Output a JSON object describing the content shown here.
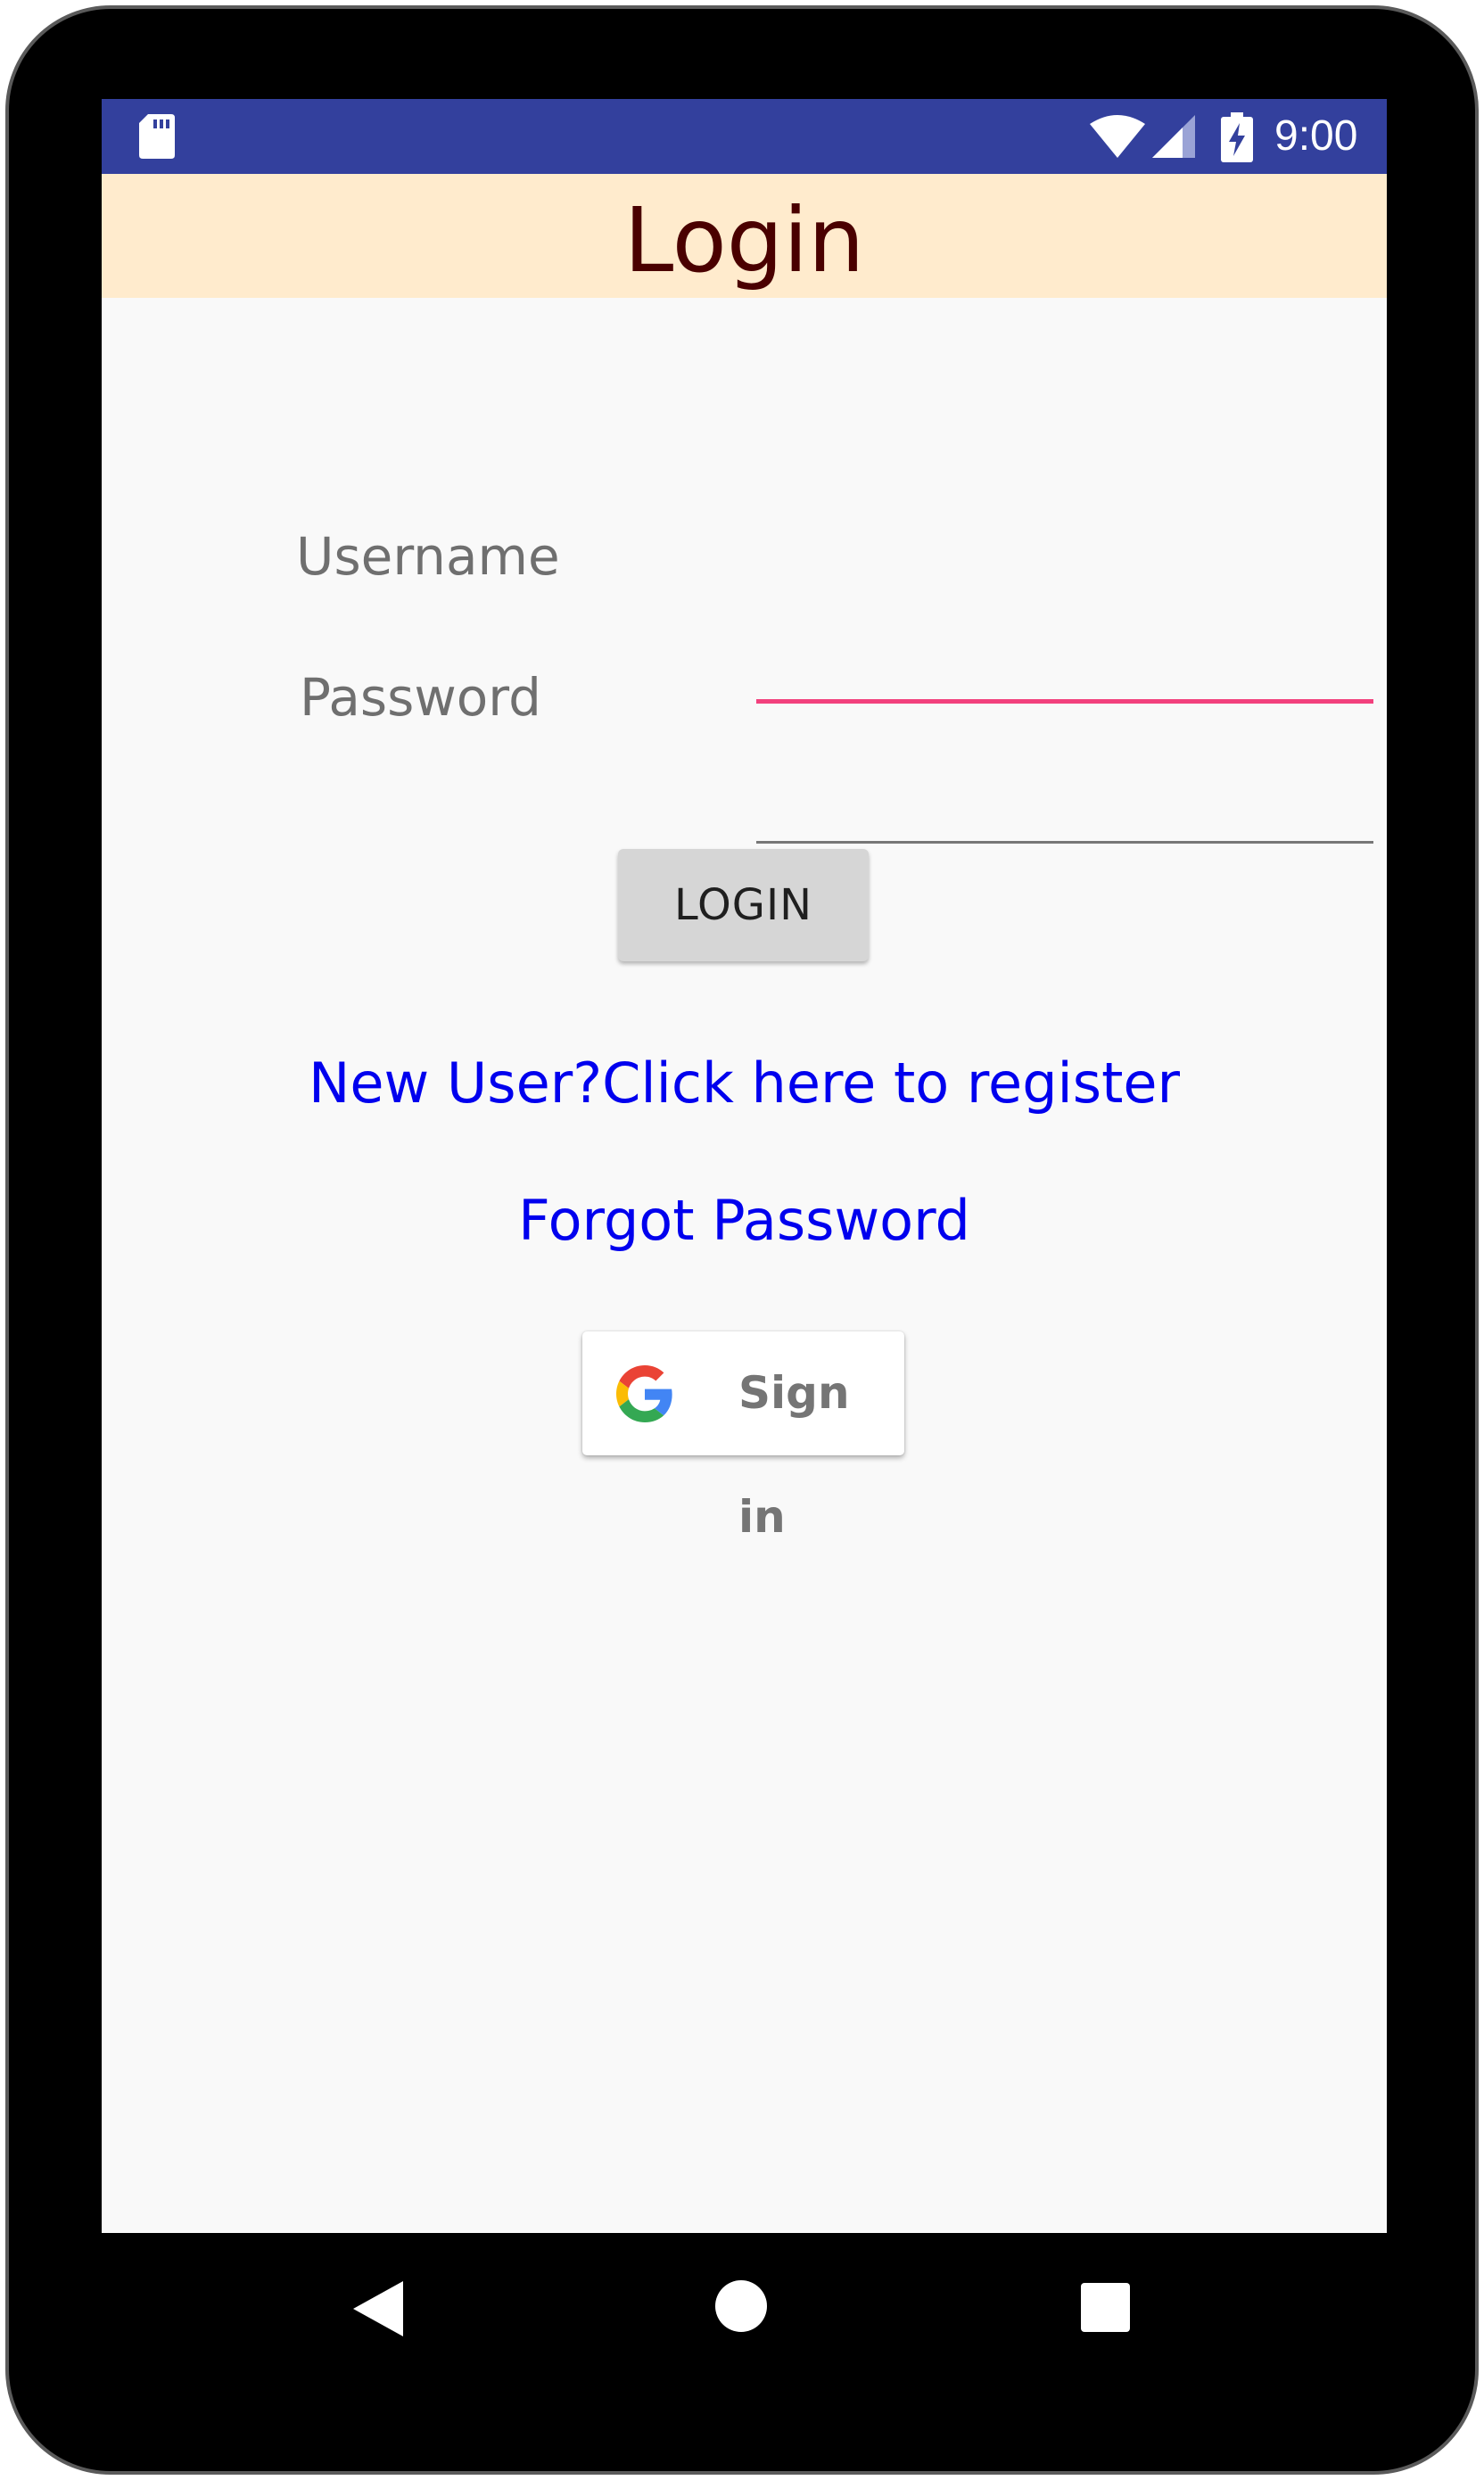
{
  "status_bar": {
    "time": "9:00",
    "icons": [
      "sd-card-icon",
      "wifi-icon",
      "signal-icon",
      "battery-charging-icon"
    ],
    "background_color": "#33409d"
  },
  "app_bar": {
    "title": "Login",
    "background_color": "#ffebcd",
    "title_color": "#4a0000"
  },
  "form": {
    "username_label": "Username",
    "username_value": "",
    "password_label": "Password",
    "password_value": "",
    "focused_field_accent": "#f2417d"
  },
  "login_button": {
    "label": "LOGIN"
  },
  "links": {
    "register": "New User?Click here to register",
    "forgot_password": "Forgot Password",
    "color": "#0000ee"
  },
  "google_sign_in": {
    "label": "Sign in",
    "icon": "google-logo-icon"
  },
  "nav_bar": {
    "icons": [
      "back-icon",
      "home-icon",
      "recent-apps-icon"
    ]
  }
}
